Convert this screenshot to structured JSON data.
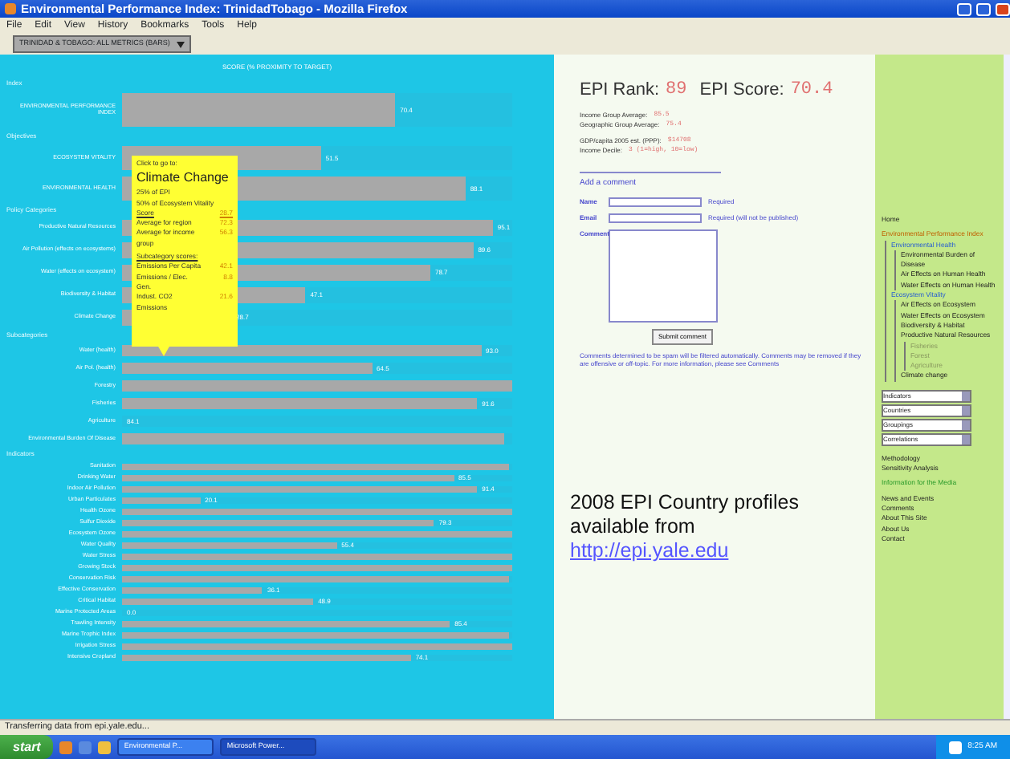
{
  "window": {
    "title": "Environmental Performance Index: TrinidadTobago - Mozilla Firefox"
  },
  "menu": [
    "File",
    "Edit",
    "View",
    "History",
    "Bookmarks",
    "Tools",
    "Help"
  ],
  "view_select": "TRINIDAD & TOBAGO: ALL METRICS (BARS)",
  "chart_header": "SCORE (% PROXIMITY TO TARGET)",
  "groups": [
    {
      "title": "Index",
      "kind": "large",
      "rows": [
        {
          "label": "ENVIRONMENTAL PERFORMANCE INDEX",
          "level": 0.7,
          "value": "70.4"
        }
      ]
    },
    {
      "title": "Objectives",
      "kind": "medium",
      "rows": [
        {
          "label": "ECOSYSTEM VITALITY",
          "level": 0.51,
          "value": "51.5"
        },
        {
          "label": "ENVIRONMENTAL HEALTH",
          "level": 0.88,
          "value": "88.1"
        }
      ]
    },
    {
      "title": "Policy Categories",
      "kind": "policy",
      "rows": [
        {
          "label": "Productive Natural Resources",
          "level": 0.95,
          "value": "95.1"
        },
        {
          "label": "Air Pollution (effects on ecosystems)",
          "level": 0.9,
          "value": "89.6"
        },
        {
          "label": "Water (effects on ecosystem)",
          "level": 0.79,
          "value": "78.7"
        },
        {
          "label": "Biodiversity & Habitat",
          "level": 0.47,
          "value": "47.1"
        },
        {
          "label": "Climate Change",
          "level": 0.28,
          "value": "28.7"
        }
      ]
    },
    {
      "title": "Subcategories",
      "kind": "sub",
      "rows": [
        {
          "label": "Water (health)",
          "level": 0.92,
          "value": "93.0"
        },
        {
          "label": "Air Pol. (health)",
          "level": 0.64,
          "value": "64.5"
        },
        {
          "label": "Forestry",
          "level": 1.0
        },
        {
          "label": "Fisheries",
          "level": 0.91,
          "value": "91.6"
        },
        {
          "label": "Agriculture",
          "value": "84.1"
        },
        {
          "label": "Environmental Burden Of Disease",
          "level": 0.98
        }
      ]
    },
    {
      "title": "Indicators",
      "kind": "small",
      "rows": [
        {
          "label": "Sanitation",
          "level": 0.99
        },
        {
          "label": "Drinking Water",
          "level": 0.85,
          "value": "85.5"
        },
        {
          "label": "Indoor Air Pollution",
          "level": 0.91,
          "value": "91.4"
        },
        {
          "label": "Urban Particulates",
          "level": 0.2,
          "value": "20.1"
        },
        {
          "label": "Health Ozone",
          "level": 1.0
        },
        {
          "label": "Sulfur Dioxide",
          "level": 0.8,
          "value": "79.3"
        },
        {
          "label": "Ecosystem Ozone",
          "level": 1.0
        },
        {
          "label": "Water Quality",
          "level": 0.55,
          "value": "55.4"
        },
        {
          "label": "Water Stress",
          "level": 1.0
        },
        {
          "label": "Growing Stock",
          "level": 1.0
        },
        {
          "label": "Conservation Risk",
          "level": 0.99
        },
        {
          "label": "Effective Conservation",
          "level": 0.36,
          "value": "36.1"
        },
        {
          "label": "Critical Habitat",
          "level": 0.49,
          "value": "48.9"
        },
        {
          "label": "Marine Protected Areas",
          "value": "0.0"
        },
        {
          "label": "Trawling Intensity",
          "level": 0.84,
          "value": "85.4"
        },
        {
          "label": "Marine Trophic Index",
          "level": 0.99
        },
        {
          "label": "Irrigation Stress",
          "level": 1.0
        },
        {
          "label": "Intensive Cropland",
          "level": 0.74,
          "value": "74.1"
        }
      ]
    }
  ],
  "tooltip": {
    "lines": [
      "Click to go to:"
    ],
    "title": "Climate Change",
    "weights": [
      "25% of EPI",
      "50% of Ecosystem Vitality"
    ],
    "scores": [
      {
        "label": "Score",
        "value": "28.7",
        "kind": "link"
      },
      {
        "label": "Average for region",
        "value": "72.3",
        "kind": "plain"
      },
      {
        "label": "Average for income group",
        "value": "56.3",
        "kind": "plain"
      }
    ],
    "sub_title": "Subcategory scores:",
    "sub_scores": [
      {
        "label": "Emissions Per Capita",
        "value": "42.1"
      },
      {
        "label": "Emissions / Elec. Gen.",
        "value": "8.8"
      },
      {
        "label": "Indust. CO2 Emissions",
        "value": "21.6"
      }
    ]
  },
  "profile": {
    "rank_label": "EPI Rank:",
    "rank": "89",
    "score_label": "EPI Score:",
    "score": "70.4",
    "facts": [
      [
        {
          "label": "Income Group Average:",
          "value": "85.5"
        },
        {
          "label": "Geographic Group Average:",
          "value": "75.4"
        }
      ],
      [
        {
          "label": "GDP/capita 2005 est. (PPP):",
          "value": "$14708"
        },
        {
          "label": "Income Decile:",
          "value": "3  (1=high, 10=low)"
        }
      ]
    ]
  },
  "comment_form": {
    "heading": "Add a comment",
    "fields": [
      {
        "label": "Name",
        "kind": "input",
        "note": "Required"
      },
      {
        "label": "Email",
        "kind": "input",
        "note": "Required (will not be published)"
      },
      {
        "label": "Comment",
        "kind": "textarea"
      }
    ],
    "submit": "Submit comment",
    "notice": "Comments determined to be spam will be filtered automatically. Comments may be removed if they are offensive or off-topic. For more information, please see ",
    "notice_link": "Comments"
  },
  "overlay": {
    "text": "2008 EPI Country profiles available from",
    "link": "http://epi.yale.edu"
  },
  "sidebar": {
    "home": "Home",
    "epi": "Environmental Performance Index",
    "tree": [
      {
        "label": "Environmental Health",
        "children": [
          {
            "label": "Environmental Burden of Disease"
          },
          {
            "label": "Air Effects on Human Health"
          },
          {
            "label": "Water Effects on Human Health"
          }
        ]
      },
      {
        "label": "Ecosystem Vitality",
        "children": [
          {
            "label": "Air Effects on Ecosystem"
          },
          {
            "label": "Water Effects on Ecosystem"
          },
          {
            "label": "Biodiversity & Habitat"
          },
          {
            "label": "Productive Natural Resources",
            "children": [
              {
                "label": "Fisheries"
              },
              {
                "label": "Forest"
              },
              {
                "label": "Agriculture"
              }
            ]
          },
          {
            "label": "Climate change"
          }
        ]
      }
    ],
    "selects": [
      "Indicators",
      "Countries",
      "Groupings",
      "Correlations"
    ],
    "links1": [
      "Methodology",
      "Sensitivity Analysis"
    ],
    "media": "Information for the Media",
    "links2": [
      "News and Events",
      "Comments",
      "About This Site",
      "About Us",
      "Contact"
    ]
  },
  "status_bar": "Transferring data from epi.yale.edu...",
  "taskbar": {
    "start": "start",
    "tasks": [
      {
        "label": "Environmental P...",
        "selected": false
      },
      {
        "label": "Microsoft Power...",
        "selected": true
      }
    ],
    "clock": "8:25 AM"
  }
}
